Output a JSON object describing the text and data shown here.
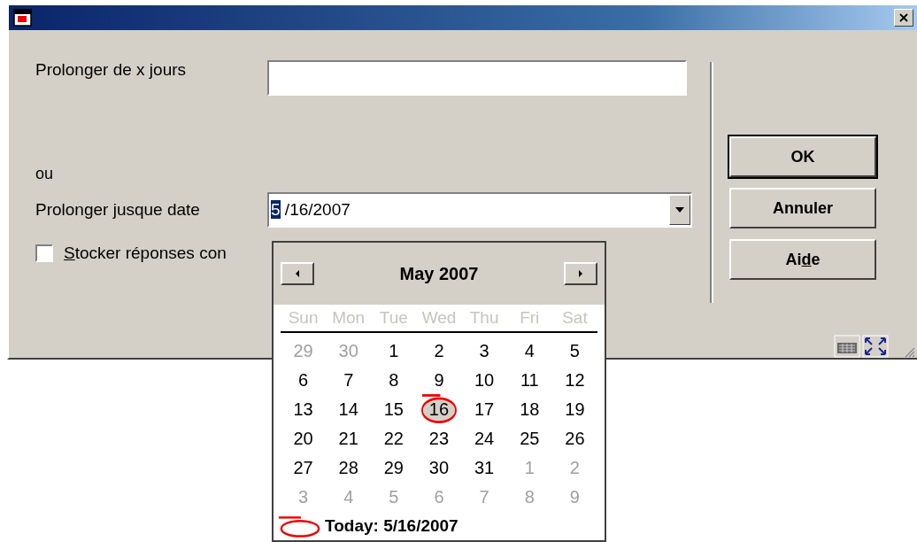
{
  "extend_days": {
    "label": "Prolonger de x jours"
  },
  "or_label": "ou",
  "extend_date": {
    "label": "Prolonger jusque date",
    "selected_part": "5",
    "rest": " /16/2007"
  },
  "store_option": {
    "key": "S",
    "after": "tocker réponses con",
    "checked": false
  },
  "buttons": [
    {
      "after": "OK",
      "default": true
    },
    {
      "after": "Annuler",
      "default": false
    },
    {
      "before": "Ai",
      "key": "d",
      "after": "e",
      "default": false
    }
  ],
  "calendar": {
    "month": "May 2007",
    "weekdays": [
      "Sun",
      "Mon",
      "Tue",
      "Wed",
      "Thu",
      "Fri",
      "Sat"
    ],
    "weeks": [
      [
        {
          "day": "29",
          "in_month": false,
          "selected": false
        },
        {
          "day": "30",
          "in_month": false,
          "selected": false
        },
        {
          "day": "1",
          "in_month": true,
          "selected": false
        },
        {
          "day": "2",
          "in_month": true,
          "selected": false
        },
        {
          "day": "3",
          "in_month": true,
          "selected": false
        },
        {
          "day": "4",
          "in_month": true,
          "selected": false
        },
        {
          "day": "5",
          "in_month": true,
          "selected": false
        }
      ],
      [
        {
          "day": "6",
          "in_month": true,
          "selected": false
        },
        {
          "day": "7",
          "in_month": true,
          "selected": false
        },
        {
          "day": "8",
          "in_month": true,
          "selected": false
        },
        {
          "day": "9",
          "in_month": true,
          "selected": false
        },
        {
          "day": "10",
          "in_month": true,
          "selected": false
        },
        {
          "day": "11",
          "in_month": true,
          "selected": false
        },
        {
          "day": "12",
          "in_month": true,
          "selected": false
        }
      ],
      [
        {
          "day": "13",
          "in_month": true,
          "selected": false
        },
        {
          "day": "14",
          "in_month": true,
          "selected": false
        },
        {
          "day": "15",
          "in_month": true,
          "selected": false
        },
        {
          "day": "16",
          "in_month": true,
          "selected": true
        },
        {
          "day": "17",
          "in_month": true,
          "selected": false
        },
        {
          "day": "18",
          "in_month": true,
          "selected": false
        },
        {
          "day": "19",
          "in_month": true,
          "selected": false
        }
      ],
      [
        {
          "day": "20",
          "in_month": true,
          "selected": false
        },
        {
          "day": "21",
          "in_month": true,
          "selected": false
        },
        {
          "day": "22",
          "in_month": true,
          "selected": false
        },
        {
          "day": "23",
          "in_month": true,
          "selected": false
        },
        {
          "day": "24",
          "in_month": true,
          "selected": false
        },
        {
          "day": "25",
          "in_month": true,
          "selected": false
        },
        {
          "day": "26",
          "in_month": true,
          "selected": false
        }
      ],
      [
        {
          "day": "27",
          "in_month": true,
          "selected": false
        },
        {
          "day": "28",
          "in_month": true,
          "selected": false
        },
        {
          "day": "29",
          "in_month": true,
          "selected": false
        },
        {
          "day": "30",
          "in_month": true,
          "selected": false
        },
        {
          "day": "31",
          "in_month": true,
          "selected": false
        },
        {
          "day": "1",
          "in_month": false,
          "selected": false
        },
        {
          "day": "2",
          "in_month": false,
          "selected": false
        }
      ],
      [
        {
          "day": "3",
          "in_month": false,
          "selected": false
        },
        {
          "day": "4",
          "in_month": false,
          "selected": false
        },
        {
          "day": "5",
          "in_month": false,
          "selected": false
        },
        {
          "day": "6",
          "in_month": false,
          "selected": false
        },
        {
          "day": "7",
          "in_month": false,
          "selected": false
        },
        {
          "day": "8",
          "in_month": false,
          "selected": false
        },
        {
          "day": "9",
          "in_month": false,
          "selected": false
        }
      ]
    ],
    "today": "Today: 5/16/2007"
  }
}
